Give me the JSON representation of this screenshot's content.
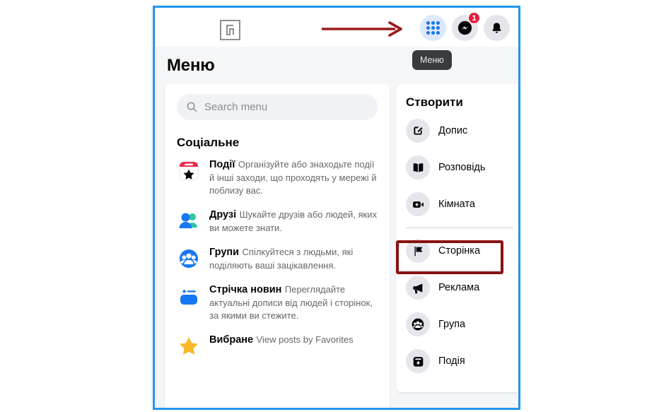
{
  "header": {
    "logo_name": "site-logo",
    "icons": [
      {
        "name": "menu-grid-icon",
        "label": "Меню",
        "badge": null
      },
      {
        "name": "messenger-icon",
        "label": "Messenger",
        "badge": "1"
      },
      {
        "name": "bell-icon",
        "label": "Сповіщення",
        "badge": null
      }
    ],
    "tooltip": "Меню"
  },
  "page": {
    "title": "Меню"
  },
  "search": {
    "placeholder": "Search menu",
    "value": ""
  },
  "social": {
    "section_title": "Соціальне",
    "items": [
      {
        "name": "events",
        "label": "Події",
        "desc": "Організуйте або знаходьте події й інші заходи, що проходять у мережі й поблизу вас.",
        "icon": "calendar-star-icon"
      },
      {
        "name": "friends",
        "label": "Друзі",
        "desc": "Шукайте друзів або людей, яких ви можете знати.",
        "icon": "friends-icon"
      },
      {
        "name": "groups",
        "label": "Групи",
        "desc": "Спілкуйтеся з людьми, які поділяють ваші зацікавлення.",
        "icon": "groups-icon"
      },
      {
        "name": "news-feed",
        "label": "Стрічка новин",
        "desc": "Переглядайте актуальні дописи від людей і сторінок, за якими ви стежите.",
        "icon": "news-feed-icon"
      },
      {
        "name": "favorites",
        "label": "Вибране",
        "desc": "View posts by Favorites",
        "icon": "star-icon"
      }
    ]
  },
  "create": {
    "section_title": "Створити",
    "items": [
      {
        "name": "post",
        "label": "Допис",
        "icon": "pencil-square-icon"
      },
      {
        "name": "story",
        "label": "Розповідь",
        "icon": "book-icon"
      },
      {
        "name": "room",
        "label": "Кімната",
        "icon": "video-plus-icon"
      },
      {
        "name": "page",
        "label": "Сторінка",
        "icon": "flag-icon",
        "highlighted": true
      },
      {
        "name": "ad",
        "label": "Реклама",
        "icon": "megaphone-icon"
      },
      {
        "name": "group",
        "label": "Група",
        "icon": "group-circle-icon"
      },
      {
        "name": "event",
        "label": "Подія",
        "icon": "calendar-plus-icon"
      }
    ]
  },
  "annotations": {
    "arrow_color": "#9b1b1b",
    "highlight_box_color": "#8b1212",
    "frame_color": "#2196f3",
    "badge_color": "#e41e3f",
    "accent_color": "#1877f2"
  }
}
